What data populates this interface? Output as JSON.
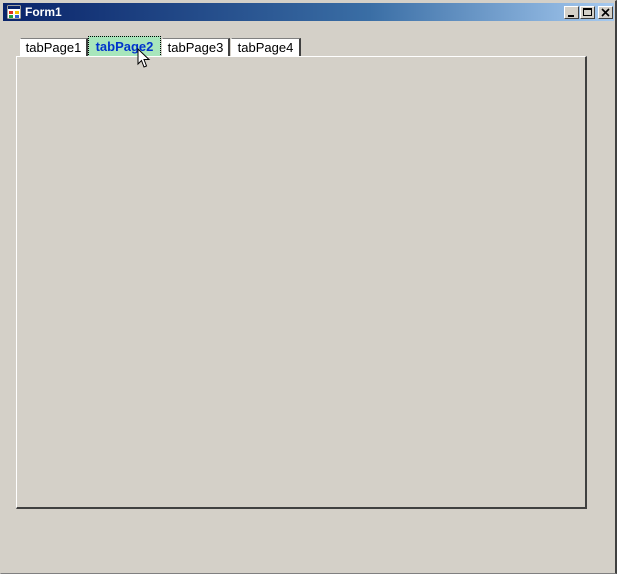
{
  "window": {
    "title": "Form1",
    "icon": "form-icon",
    "controls": {
      "minimize_icon": "minimize-icon",
      "maximize_icon": "maximize-icon",
      "close_icon": "close-icon"
    }
  },
  "tabs": [
    {
      "label": "tabPage1",
      "selected": false
    },
    {
      "label": "tabPage2",
      "selected": true
    },
    {
      "label": "tabPage3",
      "selected": false
    },
    {
      "label": "tabPage4",
      "selected": false
    }
  ],
  "colors": {
    "title_gradient_start": "#0a246a",
    "title_gradient_end": "#a6caf0",
    "selected_tab_bg": "#a8e6bc",
    "selected_tab_text": "#0033cc",
    "face": "#d4d0c8"
  },
  "cursor": {
    "icon": "arrow-cursor-icon"
  }
}
